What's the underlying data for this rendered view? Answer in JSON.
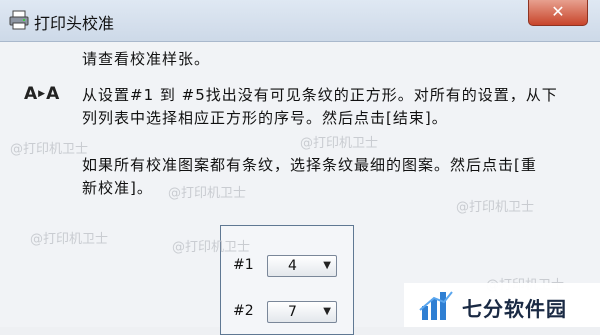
{
  "window": {
    "title": "打印头校准",
    "close_glyph": "✕"
  },
  "content": {
    "line1": "请查看校准样张。",
    "aa_left": "A",
    "aa_right": "A",
    "para1_line1": "从设置#1 到 #5找出没有可见条纹的正方形。对所有的设置，从下",
    "para1_line2": "列列表中选择相应正方形的序号。然后点击[结束]。",
    "para2_line1": "如果所有校准图案都有条纹，选择条纹最细的图案。然后点击[重",
    "para2_line2": "新校准]。"
  },
  "settings": [
    {
      "label": "#1",
      "value": "4"
    },
    {
      "label": "#2",
      "value": "7"
    }
  ],
  "watermarks": [
    "@打印机卫士",
    "@打印机卫士",
    "@打印机卫士",
    "@打印机卫士",
    "@打印机卫士",
    "@打印机卫士",
    "@打印机卫士"
  ],
  "brand": {
    "name": "七分软件园",
    "color": "#2f7fd3"
  }
}
